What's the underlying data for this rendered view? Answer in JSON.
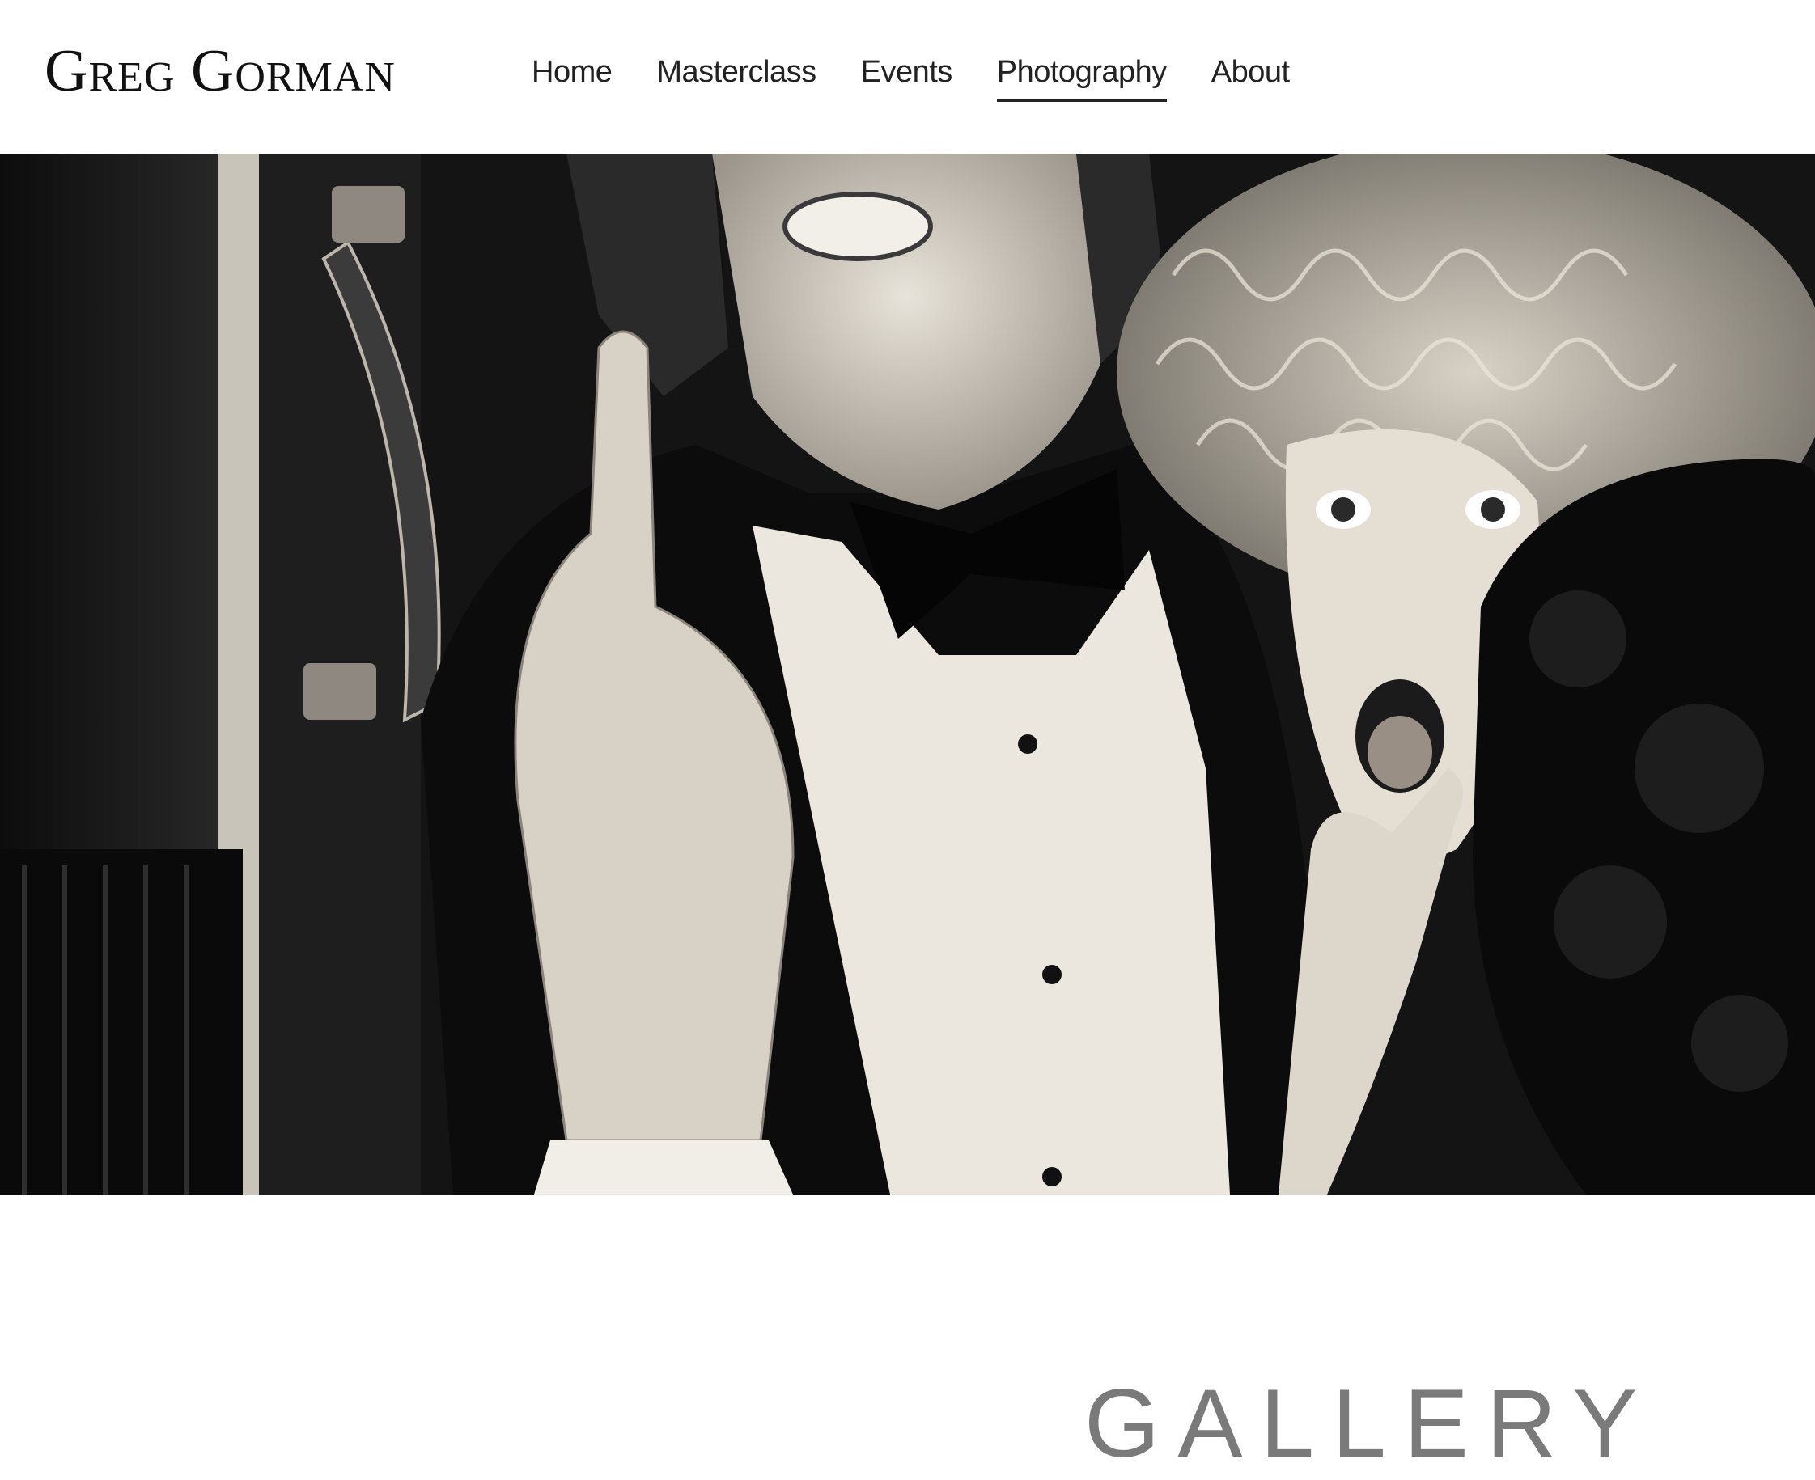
{
  "header": {
    "logo_text": "Greg Gorman"
  },
  "nav": {
    "items": [
      {
        "label": "Home",
        "active": false
      },
      {
        "label": "Masterclass",
        "active": false
      },
      {
        "label": "Events",
        "active": false
      },
      {
        "label": "Photography",
        "active": true
      },
      {
        "label": "About",
        "active": false
      }
    ]
  },
  "hero": {
    "image_style": "black-and-white photograph"
  },
  "section": {
    "title": "GALLERY"
  },
  "colors": {
    "text": "#222222",
    "gallery_title": "#7a7a7a",
    "background": "#ffffff"
  }
}
